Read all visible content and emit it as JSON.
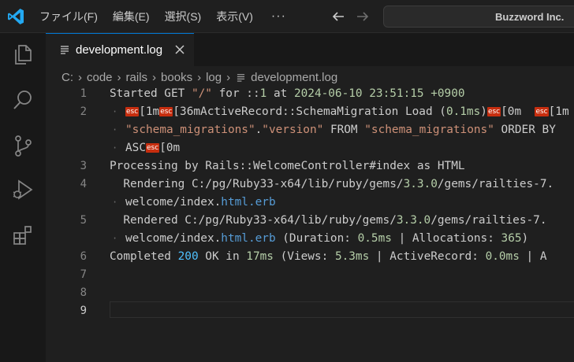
{
  "titlebar": {
    "menu": [
      "ファイル(F)",
      "編集(E)",
      "選択(S)",
      "表示(V)"
    ],
    "more": "···",
    "search_text": "Buzzword Inc.",
    "accent": "#0078d4"
  },
  "tab": {
    "label": "development.log",
    "icon": "lines-file-icon",
    "close_icon": "close-icon"
  },
  "breadcrumb": [
    "C:",
    "code",
    "rails",
    "books",
    "log",
    "development.log"
  ],
  "editor": {
    "active_line": 9,
    "lines": [
      {
        "n": "1",
        "segs": [
          {
            "t": "Started GET ",
            "c": "def"
          },
          {
            "t": "\"/\"",
            "c": "str"
          },
          {
            "t": " for ::",
            "c": "def"
          },
          {
            "t": "1",
            "c": "num"
          },
          {
            "t": " at ",
            "c": "def"
          },
          {
            "t": "2024-06-10 23:51:15 +0900",
            "c": "num"
          }
        ]
      },
      {
        "n": "2",
        "wrap": false,
        "segs": [
          {
            "t": "ESC",
            "c": "esc"
          },
          {
            "t": "[1m",
            "c": "def"
          },
          {
            "t": "ESC",
            "c": "esc"
          },
          {
            "t": "[36mActiveRecord::SchemaMigration Load (",
            "c": "def"
          },
          {
            "t": "0.1ms",
            "c": "num"
          },
          {
            "t": ")",
            "c": "def"
          },
          {
            "t": "ESC",
            "c": "esc"
          },
          {
            "t": "[0m  ",
            "c": "def"
          },
          {
            "t": "ESC",
            "c": "esc"
          },
          {
            "t": "[1m",
            "c": "def"
          }
        ]
      },
      {
        "n": "",
        "wrap": true,
        "segs": [
          {
            "t": "\"schema_migrations\"",
            "c": "str"
          },
          {
            "t": ".",
            "c": "def"
          },
          {
            "t": "\"version\"",
            "c": "str"
          },
          {
            "t": " FROM ",
            "c": "def"
          },
          {
            "t": "\"schema_migrations\"",
            "c": "str"
          },
          {
            "t": " ORDER BY",
            "c": "def"
          }
        ]
      },
      {
        "n": "",
        "wrap": true,
        "segs": [
          {
            "t": "ASC",
            "c": "def"
          },
          {
            "t": "ESC",
            "c": "esc"
          },
          {
            "t": "[0m",
            "c": "def"
          }
        ]
      },
      {
        "n": "3",
        "segs": [
          {
            "t": "Processing by Rails::WelcomeController#index as HTML",
            "c": "def"
          }
        ]
      },
      {
        "n": "4",
        "segs": [
          {
            "t": "  Rendering C:/pg/Ruby33-x64/lib/ruby/gems/",
            "c": "def"
          },
          {
            "t": "3.3.0",
            "c": "num"
          },
          {
            "t": "/gems/railties-7.",
            "c": "def"
          }
        ]
      },
      {
        "n": "",
        "wrap": true,
        "segs": [
          {
            "t": "welcome/index.",
            "c": "def"
          },
          {
            "t": "html.erb",
            "c": "file"
          }
        ]
      },
      {
        "n": "5",
        "segs": [
          {
            "t": "  Rendered C:/pg/Ruby33-x64/lib/ruby/gems/",
            "c": "def"
          },
          {
            "t": "3.3.0",
            "c": "num"
          },
          {
            "t": "/gems/railties-7.",
            "c": "def"
          }
        ]
      },
      {
        "n": "",
        "wrap": true,
        "segs": [
          {
            "t": "welcome/index.",
            "c": "def"
          },
          {
            "t": "html.erb",
            "c": "file"
          },
          {
            "t": " (Duration: ",
            "c": "def"
          },
          {
            "t": "0.5ms",
            "c": "num"
          },
          {
            "t": " | Allocations: ",
            "c": "def"
          },
          {
            "t": "365",
            "c": "num"
          },
          {
            "t": ")",
            "c": "def"
          }
        ]
      },
      {
        "n": "6",
        "segs": [
          {
            "t": "Completed ",
            "c": "def"
          },
          {
            "t": "200",
            "c": "kw"
          },
          {
            "t": " OK in ",
            "c": "def"
          },
          {
            "t": "17ms",
            "c": "num"
          },
          {
            "t": " (Views: ",
            "c": "def"
          },
          {
            "t": "5.3ms",
            "c": "num"
          },
          {
            "t": " | ActiveRecord: ",
            "c": "def"
          },
          {
            "t": "0.0ms",
            "c": "num"
          },
          {
            "t": " | A",
            "c": "def"
          }
        ]
      },
      {
        "n": "7",
        "segs": []
      },
      {
        "n": "8",
        "segs": []
      },
      {
        "n": "9",
        "segs": []
      }
    ]
  },
  "activity_icons": [
    "explorer-icon",
    "search-icon",
    "source-control-icon",
    "run-debug-icon",
    "extensions-icon"
  ]
}
